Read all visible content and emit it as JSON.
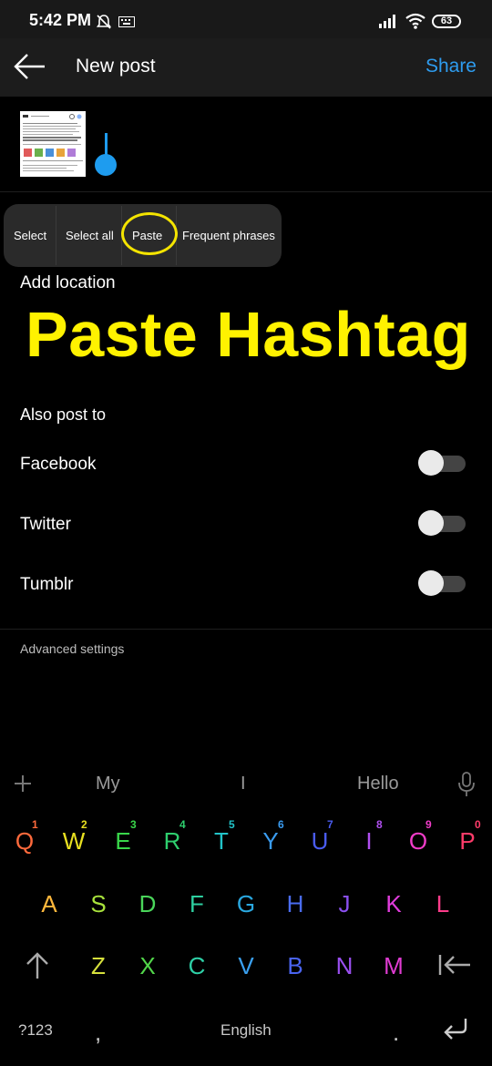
{
  "status": {
    "time": "5:42 PM",
    "battery": "63"
  },
  "appbar": {
    "title": "New post",
    "share": "Share"
  },
  "menu": {
    "select": "Select",
    "select_all": "Select all",
    "paste": "Paste",
    "frequent": "Frequent phrases"
  },
  "location": "Add location",
  "overlay": "Paste Hashtag",
  "also_post_to": "Also post to",
  "networks": [
    "Facebook",
    "Twitter",
    "Tumblr"
  ],
  "advanced": "Advanced settings",
  "keyboard": {
    "suggestions": [
      "My",
      "I",
      "Hello"
    ],
    "row1": [
      "Q",
      "W",
      "E",
      "R",
      "T",
      "Y",
      "U",
      "I",
      "O",
      "P"
    ],
    "row1_nums": [
      "1",
      "2",
      "3",
      "4",
      "5",
      "6",
      "7",
      "8",
      "9",
      "0"
    ],
    "row2": [
      "A",
      "S",
      "D",
      "F",
      "G",
      "H",
      "J",
      "K",
      "L"
    ],
    "row3": [
      "Z",
      "X",
      "C",
      "V",
      "B",
      "N",
      "M"
    ],
    "symbols": "?123",
    "comma": ",",
    "space": "English",
    "period": "."
  },
  "colors": {
    "accent": "#2e9cef",
    "highlight": "#fff200",
    "row1": [
      "#ff6a3c",
      "#e8e020",
      "#39d64a",
      "#2ecf6e",
      "#22c4c9",
      "#3a9cf0",
      "#4a5cf0",
      "#b04ff0",
      "#f03cc8",
      "#ff3c6a"
    ],
    "row2": [
      "#ffb83c",
      "#a8e23c",
      "#4ad65a",
      "#2ecfa0",
      "#2aa8e0",
      "#4a6cf0",
      "#8a4ff0",
      "#e03cdc",
      "#ff3c8a"
    ],
    "row3": [
      "#d6e03c",
      "#52d64a",
      "#2ecfa6",
      "#3aa0f0",
      "#4a64f0",
      "#9a4ff0",
      "#e03cd2"
    ]
  }
}
